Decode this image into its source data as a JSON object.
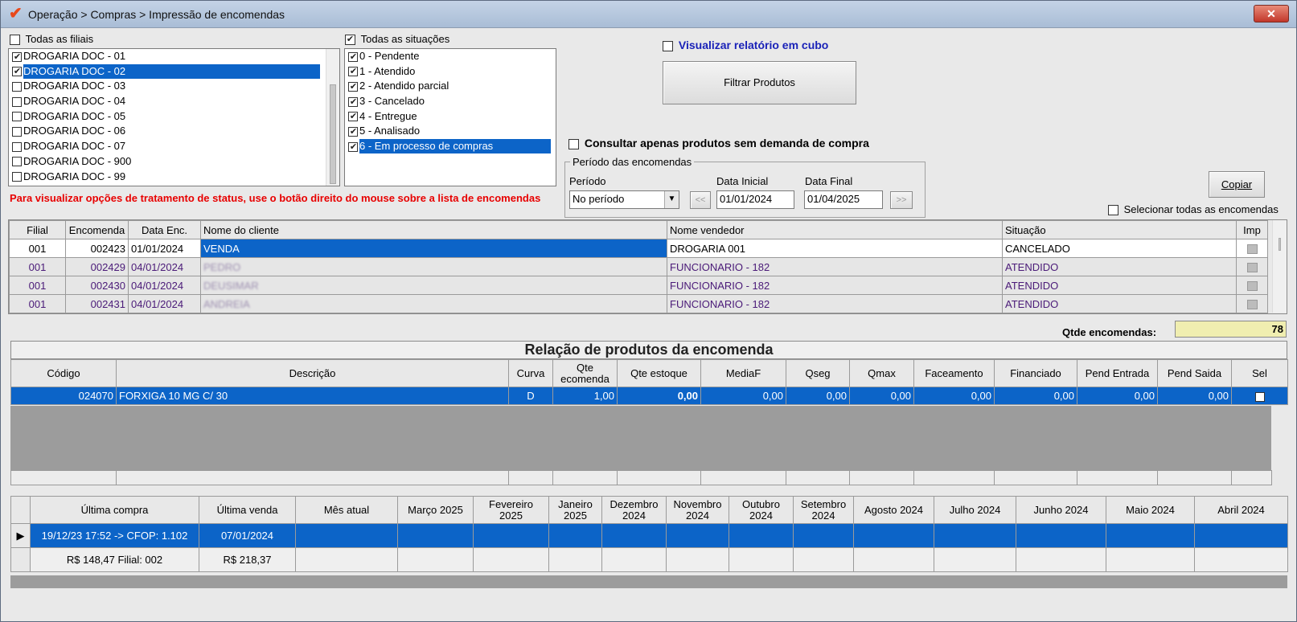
{
  "window": {
    "title": "Operação > Compras > Impressão de encomendas",
    "close_label": "✕"
  },
  "filiais": {
    "all_label": "Todas as filiais",
    "all_checked": false,
    "items": [
      {
        "label": "DROGARIA DOC - 01",
        "checked": true
      },
      {
        "label": "DROGARIA DOC - 02",
        "checked": true
      },
      {
        "label": "DROGARIA DOC - 03",
        "checked": false
      },
      {
        "label": "DROGARIA DOC - 04",
        "checked": false
      },
      {
        "label": "DROGARIA DOC - 05",
        "checked": false
      },
      {
        "label": "DROGARIA DOC - 06",
        "checked": false
      },
      {
        "label": "DROGARIA DOC - 07",
        "checked": false
      },
      {
        "label": "DROGARIA DOC - 900",
        "checked": false
      },
      {
        "label": "DROGARIA DOC - 99",
        "checked": false
      }
    ]
  },
  "situacoes": {
    "all_label": "Todas as situações",
    "all_checked": true,
    "items": [
      {
        "label": "0 - Pendente",
        "checked": true
      },
      {
        "label": "1 - Atendido",
        "checked": true
      },
      {
        "label": "2 - Atendido parcial",
        "checked": true
      },
      {
        "label": "3 - Cancelado",
        "checked": true
      },
      {
        "label": "4 - Entregue",
        "checked": true
      },
      {
        "label": "5 - Analisado",
        "checked": true
      },
      {
        "label": "6 - Em processo de compras",
        "checked": true
      }
    ]
  },
  "cubo_label": "Visualizar relatório em cubo",
  "filtrar_label": "Filtrar Produtos",
  "sem_demanda_label": "Consultar apenas produtos sem demanda de compra",
  "periodo_group": {
    "legend": "Período das encomendas",
    "periodo_label": "Período",
    "periodo_value": "No período",
    "data_inicial_label": "Data Inicial",
    "data_inicial": "01/01/2024",
    "data_final_label": "Data Final",
    "data_final": "01/04/2025",
    "prev_label": "<<",
    "next_label": ">>"
  },
  "copiar_label": "Copiar",
  "selecionar_todas_label": "Selecionar todas as encomendas",
  "status_hint": "Para visualizar opções de tratamento de status, use o botão direito do mouse sobre a lista de encomendas",
  "encomendas": {
    "headers": [
      "Filial",
      "Encomenda",
      "Data Enc.",
      "Nome do cliente",
      "Nome vendedor",
      "Situação",
      "Imp"
    ],
    "rows": [
      {
        "filial": "001",
        "encomenda": "002423",
        "data": "01/01/2024",
        "cliente": "VENDA",
        "vendedor": "DROGARIA 001",
        "situacao": "CANCELADO"
      },
      {
        "filial": "001",
        "encomenda": "002429",
        "data": "04/01/2024",
        "cliente": "PEDRO",
        "vendedor": "FUNCIONARIO - 182",
        "situacao": "ATENDIDO"
      },
      {
        "filial": "001",
        "encomenda": "002430",
        "data": "04/01/2024",
        "cliente": "DEUSIMAR",
        "vendedor": "FUNCIONARIO - 182",
        "situacao": "ATENDIDO"
      },
      {
        "filial": "001",
        "encomenda": "002431",
        "data": "04/01/2024",
        "cliente": "ANDREIA",
        "vendedor": "FUNCIONARIO - 182",
        "situacao": "ATENDIDO"
      }
    ]
  },
  "qtde_encomendas_label": "Qtde encomendas:",
  "qtde_encomendas_value": "78",
  "produtos": {
    "title": "Relação de produtos da encomenda",
    "headers": [
      "Código",
      "Descrição",
      "Curva",
      "Qte ecomenda",
      "Qte estoque",
      "MediaF",
      "Qseg",
      "Qmax",
      "Faceamento",
      "Financiado",
      "Pend Entrada",
      "Pend Saida",
      "Sel"
    ],
    "rows": [
      {
        "codigo": "024070",
        "descricao": "FORXIGA 10 MG C/ 30",
        "curva": "D",
        "qte_encomenda": "1,00",
        "qte_estoque": "0,00",
        "mediaf": "0,00",
        "qseg": "0,00",
        "qmax": "0,00",
        "faceamento": "0,00",
        "financiado": "0,00",
        "pend_entrada": "0,00",
        "pend_saida": "0,00"
      }
    ]
  },
  "historico": {
    "headers": [
      "Última compra",
      "Última venda",
      "Mês atual",
      "Março 2025",
      "Fevereiro 2025",
      "Janeiro 2025",
      "Dezembro 2024",
      "Novembro 2024",
      "Outubro 2024",
      "Setembro 2024",
      "Agosto 2024",
      "Julho 2024",
      "Junho 2024",
      "Maio 2024",
      "Abril 2024"
    ],
    "row1": {
      "ultima_compra": "19/12/23 17:52 -> CFOP: 1.102",
      "ultima_venda": "07/01/2024"
    },
    "row2": {
      "ultima_compra": "R$ 148,47 Filial: 002",
      "ultima_venda": "R$ 218,37"
    }
  }
}
